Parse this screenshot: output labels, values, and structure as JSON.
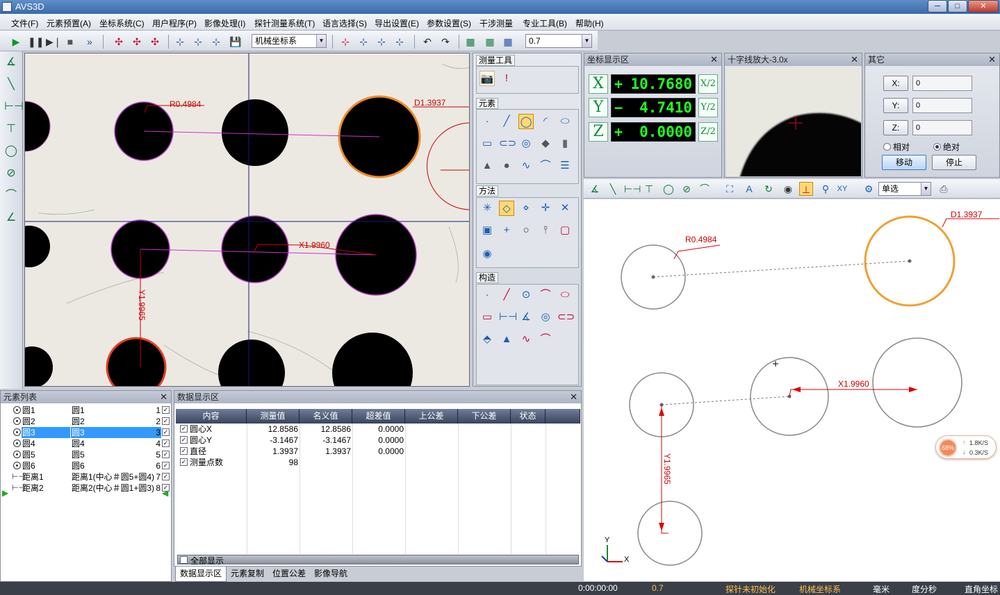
{
  "app": {
    "title": "AVS3D"
  },
  "window": {
    "min": "─",
    "max": "□",
    "close": "✕"
  },
  "menu": [
    "文件(F)",
    "元素预置(A)",
    "坐标系统(C)",
    "用户程序(P)",
    "影像处理(I)",
    "探针测量系统(T)",
    "语言选择(S)",
    "导出设置(E)",
    "参数设置(S)",
    "干涉测量",
    "专业工具(B)",
    "帮助(H)"
  ],
  "toolbar": {
    "coord_system": "机械坐标系",
    "zoom_value": "0.7"
  },
  "camera": {
    "labels": {
      "r": "R0.4984",
      "d": "D1.3937",
      "x": "X1.9960",
      "y": "Y1.9965"
    }
  },
  "panels": {
    "measure_tools": "测量工具",
    "elements": "元素",
    "method": "方法",
    "construct": "构造",
    "coord_title": "坐标显示区",
    "cross_title": "十字线放大-3.0x",
    "other_title": "其它",
    "elist_title": "元素列表",
    "data_title": "数据显示区"
  },
  "coords": {
    "x": {
      "axis": "X",
      "sign": "+",
      "value": "10.7680",
      "half": "X/2"
    },
    "y": {
      "axis": "Y",
      "sign": "−",
      "value": "4.7410",
      "half": "Y/2"
    },
    "z": {
      "axis": "Z",
      "sign": "+",
      "value": "0.0000",
      "half": "Z/2"
    }
  },
  "other": {
    "x_label": "X:",
    "x_val": "0",
    "y_label": "Y:",
    "y_val": "0",
    "z_label": "Z:",
    "z_val": "0",
    "relative": "相对",
    "absolute": "绝对",
    "move": "移动",
    "stop": "停止"
  },
  "cad": {
    "select_mode": "单选",
    "xy": "XY",
    "labels": {
      "r": "R0.4984",
      "d": "D1.3937",
      "x": "X1.9960",
      "y": "Y1.9965"
    },
    "axis_x": "X",
    "axis_y": "Y"
  },
  "speed": {
    "percent": "68%",
    "up": "1.8K/S",
    "down": "0.3K/S"
  },
  "element_list": [
    {
      "name": "圆1",
      "desc": "圆1",
      "num": "1",
      "sel": false,
      "type": "circle"
    },
    {
      "name": "圆2",
      "desc": "圆2",
      "num": "2",
      "sel": false,
      "type": "circle"
    },
    {
      "name": "圆3",
      "desc": "圆3",
      "num": "3",
      "sel": true,
      "type": "circle"
    },
    {
      "name": "圆4",
      "desc": "圆4",
      "num": "4",
      "sel": false,
      "type": "circle"
    },
    {
      "name": "圆5",
      "desc": "圆5",
      "num": "5",
      "sel": false,
      "type": "circle"
    },
    {
      "name": "圆6",
      "desc": "圆6",
      "num": "6",
      "sel": false,
      "type": "circle"
    },
    {
      "name": "距离1",
      "desc": "距离1(中心＃圆5+圆4)",
      "num": "7",
      "sel": false,
      "type": "dist"
    },
    {
      "name": "距离2",
      "desc": "距离2(中心＃圆1+圆3)",
      "num": "8",
      "sel": false,
      "type": "dist"
    }
  ],
  "data_table": {
    "headers": [
      "内容",
      "测量值",
      "名义值",
      "超差值",
      "上公差",
      "下公差",
      "状态"
    ],
    "rows": [
      {
        "name": "圆心X",
        "measured": "12.8586",
        "nominal": "12.8586",
        "over": "0.0000"
      },
      {
        "name": "圆心Y",
        "measured": "-3.1467",
        "nominal": "-3.1467",
        "over": "0.0000"
      },
      {
        "name": "直径",
        "measured": "1.3937",
        "nominal": "1.3937",
        "over": "0.0000"
      },
      {
        "name": "测量点数",
        "measured": "98",
        "nominal": "",
        "over": ""
      }
    ],
    "show_all": "全部显示"
  },
  "tabs": [
    "数据显示区",
    "元素复制",
    "位置公差",
    "影像导航"
  ],
  "status": {
    "time": "0:00:00:00",
    "zoom": "0.7",
    "probe": "探针未初始化",
    "coord": "机械坐标系",
    "unit": "毫米",
    "angle": "度分秒",
    "rect": "直角坐标"
  }
}
